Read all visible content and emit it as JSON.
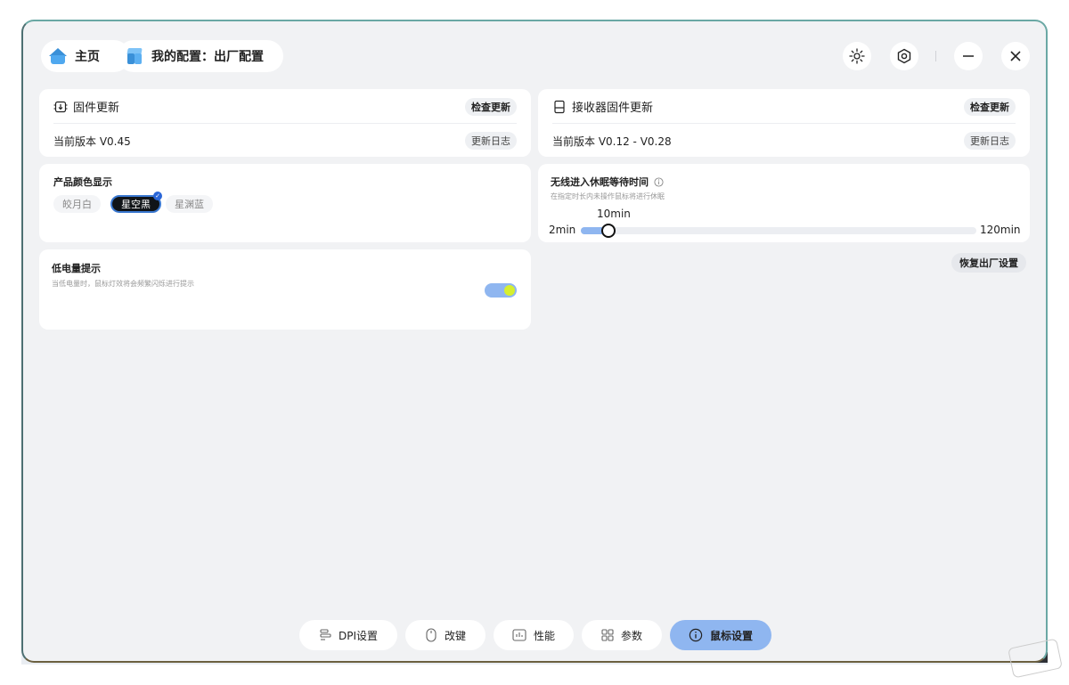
{
  "header": {
    "home_label": "主页",
    "profile_label": "我的配置：出厂配置"
  },
  "firmware": {
    "title": "固件更新",
    "check_label": "检查更新",
    "version_text": "当前版本 V0.45",
    "log_label": "更新日志"
  },
  "receiver": {
    "title": "接收器固件更新",
    "check_label": "检查更新",
    "version_text": "当前版本 V0.12 - V0.28",
    "log_label": "更新日志"
  },
  "color_display": {
    "title": "产品颜色显示",
    "options": [
      "皎月白",
      "星空黑",
      "星渊蓝"
    ],
    "selected": "星空黑"
  },
  "sleep": {
    "title": "无线进入休眠等待时间",
    "description": "在指定时长内未操作鼠标将进行休眠",
    "value_label": "10min",
    "min_label": "2min",
    "max_label": "120min",
    "value_fraction": 0.07
  },
  "low_battery": {
    "title": "低电量提示",
    "description": "当低电量时，鼠标灯效将会频繁闪烁进行提示",
    "enabled": true
  },
  "reset_label": "恢复出厂设置",
  "nav": {
    "dpi": "DPI设置",
    "remap": "改键",
    "performance": "性能",
    "params": "参数",
    "mouse_settings": "鼠标设置",
    "active": "鼠标设置"
  },
  "icons": {
    "home": "home-icon",
    "profile": "cube-icon",
    "brightness": "sun-icon",
    "settings": "gear-icon",
    "minimize": "minus-icon",
    "close": "close-icon",
    "firmware": "chip-icon",
    "receiver": "receiver-icon",
    "info": "info-icon"
  },
  "colors": {
    "accent": "#8fb6f0",
    "toggle_dot": "#d6ef2e",
    "selected_check": "#2a66d8"
  }
}
